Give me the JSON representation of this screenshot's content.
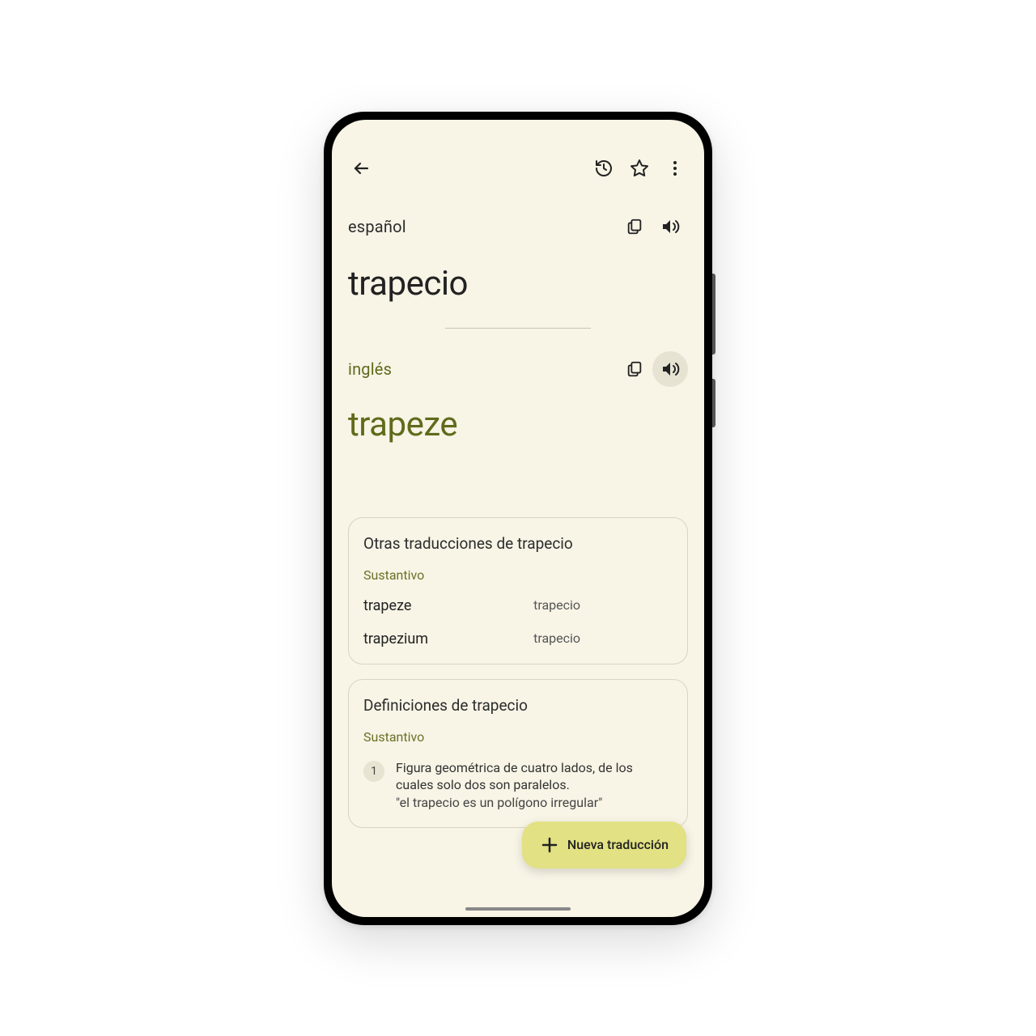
{
  "source": {
    "lang_label": "español",
    "word": "trapecio"
  },
  "target": {
    "lang_label": "inglés",
    "word": "trapeze"
  },
  "other_translations": {
    "title": "Otras traducciones de trapecio",
    "part_of_speech": "Sustantivo",
    "rows": [
      {
        "translation": "trapeze",
        "original": "trapecio"
      },
      {
        "translation": "trapezium",
        "original": "trapecio"
      }
    ]
  },
  "definitions": {
    "title": "Definiciones de trapecio",
    "part_of_speech": "Sustantivo",
    "items": [
      {
        "num": "1",
        "text": "Figura geométrica de cuatro lados, de los cuales solo dos son paralelos.",
        "example": "\"el trapecio es un polígono irregular\""
      }
    ]
  },
  "fab": {
    "label": "Nueva traducción"
  }
}
